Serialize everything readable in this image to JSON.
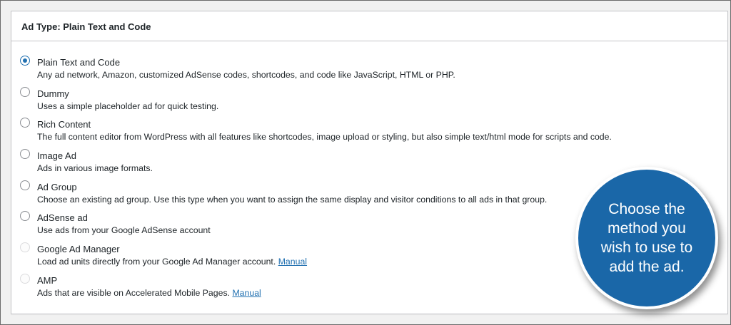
{
  "panel": {
    "title": "Ad Type: Plain Text and Code"
  },
  "options": [
    {
      "label": "Plain Text and Code",
      "description": "Any ad network, Amazon, customized AdSense codes, shortcodes, and code like JavaScript, HTML or PHP.",
      "checked": true,
      "disabled": false
    },
    {
      "label": "Dummy",
      "description": "Uses a simple placeholder ad for quick testing.",
      "checked": false,
      "disabled": false
    },
    {
      "label": "Rich Content",
      "description": "The full content editor from WordPress with all features like shortcodes, image upload or styling, but also simple text/html mode for scripts and code.",
      "checked": false,
      "disabled": false
    },
    {
      "label": "Image Ad",
      "description": "Ads in various image formats.",
      "checked": false,
      "disabled": false
    },
    {
      "label": "Ad Group",
      "description": "Choose an existing ad group. Use this type when you want to assign the same display and visitor conditions to all ads in that group.",
      "checked": false,
      "disabled": false
    },
    {
      "label": "AdSense ad",
      "description": "Use ads from your Google AdSense account",
      "checked": false,
      "disabled": false
    },
    {
      "label": "Google Ad Manager",
      "description": "Load ad units directly from your Google Ad Manager account.",
      "link": "Manual",
      "checked": false,
      "disabled": true
    },
    {
      "label": "AMP",
      "description": "Ads that are visible on Accelerated Mobile Pages.",
      "link": "Manual",
      "checked": false,
      "disabled": true
    }
  ],
  "callout": {
    "text": "Choose the method you wish to use to add the ad."
  },
  "colors": {
    "accent": "#2271b1",
    "callout_bg": "#1a67a8"
  }
}
